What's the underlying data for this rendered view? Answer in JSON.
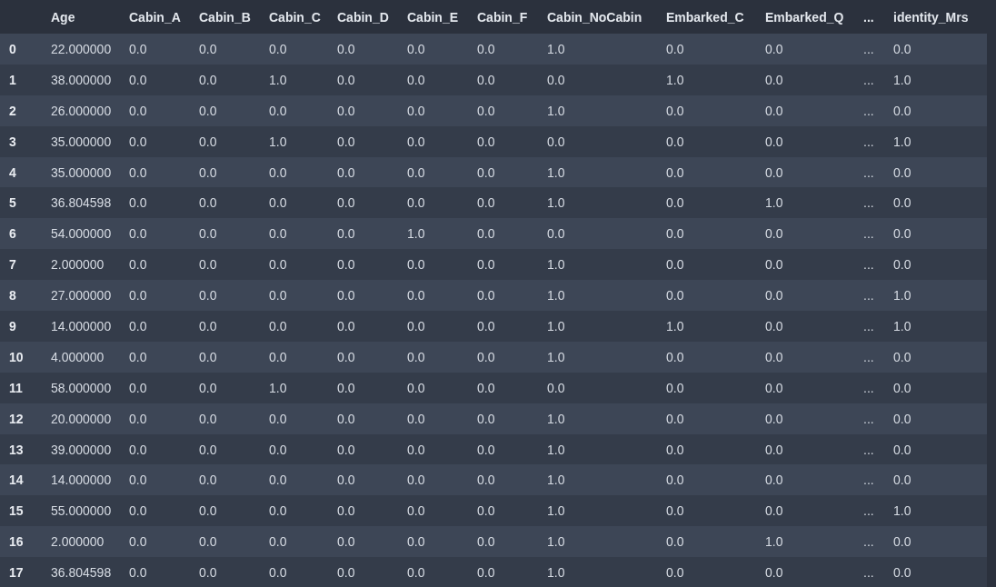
{
  "table": {
    "columns": [
      "",
      "Age",
      "Cabin_A",
      "Cabin_B",
      "Cabin_C",
      "Cabin_D",
      "Cabin_E",
      "Cabin_F",
      "Cabin_NoCabin",
      "Embarked_C",
      "Embarked_Q",
      "...",
      "identity_Mrs"
    ],
    "rows": [
      [
        "0",
        "22.000000",
        "0.0",
        "0.0",
        "0.0",
        "0.0",
        "0.0",
        "0.0",
        "1.0",
        "0.0",
        "0.0",
        "...",
        "0.0"
      ],
      [
        "1",
        "38.000000",
        "0.0",
        "0.0",
        "1.0",
        "0.0",
        "0.0",
        "0.0",
        "0.0",
        "1.0",
        "0.0",
        "...",
        "1.0"
      ],
      [
        "2",
        "26.000000",
        "0.0",
        "0.0",
        "0.0",
        "0.0",
        "0.0",
        "0.0",
        "1.0",
        "0.0",
        "0.0",
        "...",
        "0.0"
      ],
      [
        "3",
        "35.000000",
        "0.0",
        "0.0",
        "1.0",
        "0.0",
        "0.0",
        "0.0",
        "0.0",
        "0.0",
        "0.0",
        "...",
        "1.0"
      ],
      [
        "4",
        "35.000000",
        "0.0",
        "0.0",
        "0.0",
        "0.0",
        "0.0",
        "0.0",
        "1.0",
        "0.0",
        "0.0",
        "...",
        "0.0"
      ],
      [
        "5",
        "36.804598",
        "0.0",
        "0.0",
        "0.0",
        "0.0",
        "0.0",
        "0.0",
        "1.0",
        "0.0",
        "1.0",
        "...",
        "0.0"
      ],
      [
        "6",
        "54.000000",
        "0.0",
        "0.0",
        "0.0",
        "0.0",
        "1.0",
        "0.0",
        "0.0",
        "0.0",
        "0.0",
        "...",
        "0.0"
      ],
      [
        "7",
        "2.000000",
        "0.0",
        "0.0",
        "0.0",
        "0.0",
        "0.0",
        "0.0",
        "1.0",
        "0.0",
        "0.0",
        "...",
        "0.0"
      ],
      [
        "8",
        "27.000000",
        "0.0",
        "0.0",
        "0.0",
        "0.0",
        "0.0",
        "0.0",
        "1.0",
        "0.0",
        "0.0",
        "...",
        "1.0"
      ],
      [
        "9",
        "14.000000",
        "0.0",
        "0.0",
        "0.0",
        "0.0",
        "0.0",
        "0.0",
        "1.0",
        "1.0",
        "0.0",
        "...",
        "1.0"
      ],
      [
        "10",
        "4.000000",
        "0.0",
        "0.0",
        "0.0",
        "0.0",
        "0.0",
        "0.0",
        "1.0",
        "0.0",
        "0.0",
        "...",
        "0.0"
      ],
      [
        "11",
        "58.000000",
        "0.0",
        "0.0",
        "1.0",
        "0.0",
        "0.0",
        "0.0",
        "0.0",
        "0.0",
        "0.0",
        "...",
        "0.0"
      ],
      [
        "12",
        "20.000000",
        "0.0",
        "0.0",
        "0.0",
        "0.0",
        "0.0",
        "0.0",
        "1.0",
        "0.0",
        "0.0",
        "...",
        "0.0"
      ],
      [
        "13",
        "39.000000",
        "0.0",
        "0.0",
        "0.0",
        "0.0",
        "0.0",
        "0.0",
        "1.0",
        "0.0",
        "0.0",
        "...",
        "0.0"
      ],
      [
        "14",
        "14.000000",
        "0.0",
        "0.0",
        "0.0",
        "0.0",
        "0.0",
        "0.0",
        "1.0",
        "0.0",
        "0.0",
        "...",
        "0.0"
      ],
      [
        "15",
        "55.000000",
        "0.0",
        "0.0",
        "0.0",
        "0.0",
        "0.0",
        "0.0",
        "1.0",
        "0.0",
        "0.0",
        "...",
        "1.0"
      ],
      [
        "16",
        "2.000000",
        "0.0",
        "0.0",
        "0.0",
        "0.0",
        "0.0",
        "0.0",
        "1.0",
        "0.0",
        "1.0",
        "...",
        "0.0"
      ],
      [
        "17",
        "36.804598",
        "0.0",
        "0.0",
        "0.0",
        "0.0",
        "0.0",
        "0.0",
        "1.0",
        "0.0",
        "0.0",
        "...",
        "0.0"
      ]
    ]
  }
}
